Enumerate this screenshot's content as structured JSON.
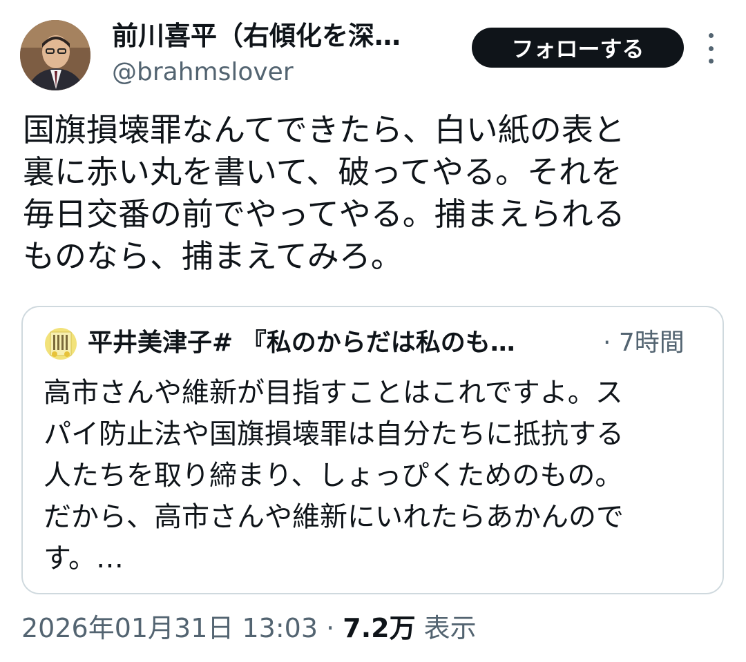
{
  "author": {
    "display_name": "前川喜平（右傾化を深…",
    "handle": "@brahmslover"
  },
  "follow_button_label": "フォローする",
  "tweet_text_lines": [
    "国旗損壊罪なんてできたら、白い紙の表と",
    "裏に赤い丸を書いて、破ってやる。それを",
    "毎日交番の前でやってやる。捕まえられる",
    "ものなら、捕まえてみろ。"
  ],
  "quoted_tweet": {
    "display_name": "平井美津子# 『私のからだは私のも…",
    "time": "· 7時間",
    "text_lines": [
      "高市さんや維新が目指すことはこれですよ。ス",
      "パイ防止法や国旗損壊罪は自分たちに抵抗する",
      "人たちを取り締まり、しょっぴくためのもの。",
      "だから、高市さんや維新にいれたらあかんので",
      "す。…"
    ]
  },
  "footer": {
    "timestamp": "2026年01月31日 13:03",
    "separator": " · ",
    "view_count": "7.2万",
    "view_label": " 表示"
  },
  "colors": {
    "text_primary": "#0f1419",
    "text_secondary": "#536471",
    "border": "#cfd9de",
    "button_bg": "#0f1419"
  }
}
